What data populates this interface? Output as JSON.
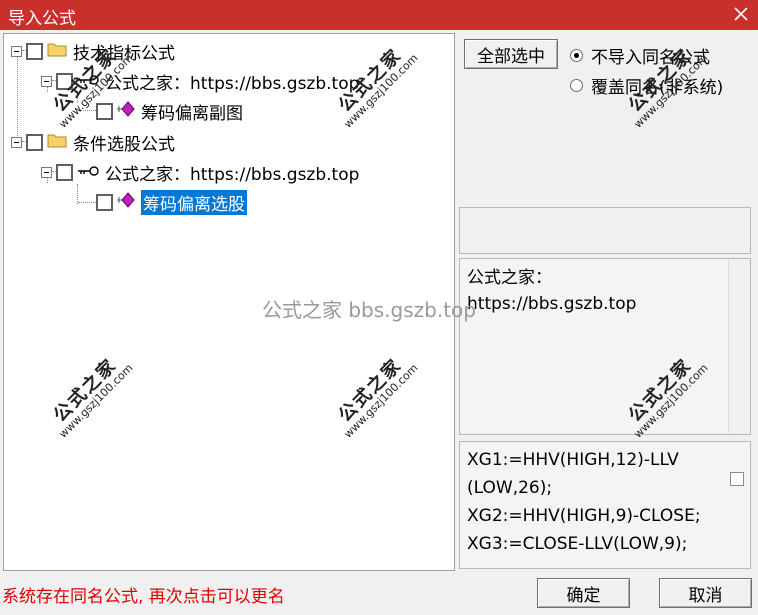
{
  "window": {
    "title": "导入公式"
  },
  "tree": {
    "nodes": [
      {
        "label": "技术指标公式",
        "icon": "folder-icon"
      },
      {
        "label": "公式之家：https://bbs.gszb.top",
        "icon": "key-icon"
      },
      {
        "label": "筹码偏离副图",
        "icon": "formula-icon"
      },
      {
        "label": "条件选股公式",
        "icon": "folder-icon"
      },
      {
        "label": "公式之家：https://bbs.gszb.top",
        "icon": "key-icon"
      },
      {
        "label": "筹码偏离选股",
        "icon": "formula-icon",
        "selected": true
      }
    ]
  },
  "options": {
    "select_all_label": "全部选中",
    "radio_no_import": "不导入同名公式",
    "radio_overwrite": "覆盖同名(非系统)",
    "selected_radio": "no_import"
  },
  "description": {
    "line1": "公式之家：",
    "line2": "https://bbs.gszb.top"
  },
  "code": {
    "lines": [
      "XG1:=HHV(HIGH,12)-LLV",
      "(LOW,26);",
      "XG2:=HHV(HIGH,9)-CLOSE;",
      "XG3:=CLOSE-LLV(LOW,9);"
    ]
  },
  "footer": {
    "status": "系统存在同名公式, 再次点击可以更名",
    "ok_label": "确定",
    "cancel_label": "取消"
  },
  "watermark": {
    "text": "公式之家 bbs.gszb.top",
    "stamp_title": "公式之家",
    "stamp_url": "www.gszj100.com"
  },
  "colors": {
    "titlebar": "#c9302c",
    "selection": "#0078d7",
    "status_text": "#e00000",
    "formula_icon": "#c020c0"
  }
}
